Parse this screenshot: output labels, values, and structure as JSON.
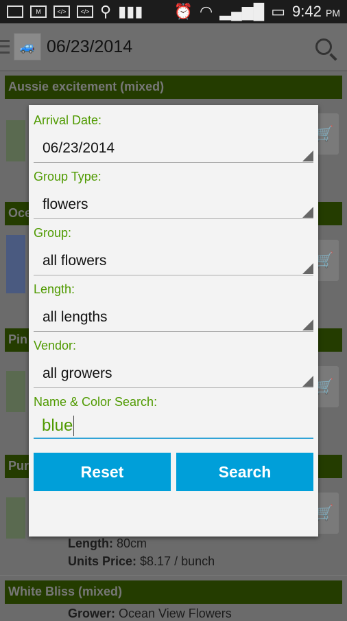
{
  "status_bar": {
    "time": "9:42",
    "ampm": "PM"
  },
  "app_bar": {
    "title": "06/23/2014"
  },
  "list": {
    "groups": [
      "Aussie excitement  (mixed)",
      "Oce",
      "Pin",
      "Pur",
      "White Bliss (mixed)"
    ],
    "details": [
      {
        "label": "Length:",
        "value": " 80cm"
      },
      {
        "label": "Units Price:",
        "value": " $8.17 / bunch"
      },
      {
        "label": "Grower:",
        "value": " Ocean View Flowers"
      }
    ]
  },
  "dialog": {
    "fields": [
      {
        "label": "Arrival Date:",
        "value": "06/23/2014"
      },
      {
        "label": "Group Type:",
        "value": "flowers"
      },
      {
        "label": "Group:",
        "value": "all flowers"
      },
      {
        "label": "Length:",
        "value": "all lengths"
      },
      {
        "label": "Vendor:",
        "value": "all growers"
      }
    ],
    "search_label": "Name & Color Search:",
    "search_value": "blue",
    "reset": "Reset",
    "search": "Search"
  },
  "colors": {
    "accent": "#009fd9",
    "label_green": "#4f9a00",
    "group_header": "#243c00"
  }
}
